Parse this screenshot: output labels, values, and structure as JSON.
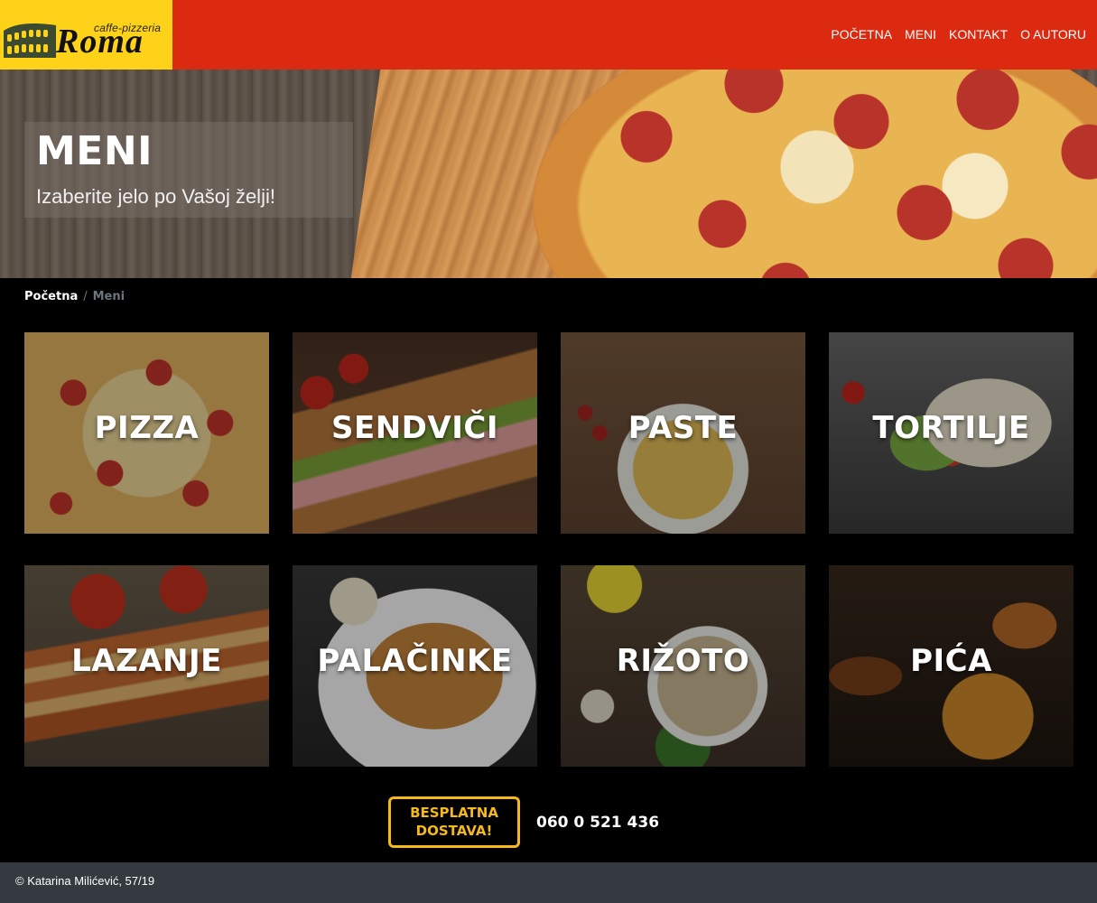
{
  "header": {
    "logo": {
      "small": "caffe-pizzeria",
      "big": "Roma"
    },
    "nav": [
      "POČETNA",
      "MENI",
      "KONTAKT",
      "O AUTORU"
    ],
    "colors": {
      "header_bg": "#dc2a10",
      "logo_bg": "#ffd21a"
    }
  },
  "hero": {
    "title": "MENI",
    "subtitle": "Izaberite jelo po Vašoj želji!"
  },
  "breadcrumb": {
    "home": "Početna",
    "separator": "/",
    "current": "Meni"
  },
  "categories": [
    {
      "label": "PIZZA",
      "image": "pizza"
    },
    {
      "label": "SENDVIČI",
      "image": "sandwich"
    },
    {
      "label": "PASTE",
      "image": "pasta"
    },
    {
      "label": "TORTILJE",
      "image": "tortilla"
    },
    {
      "label": "LAZANJE",
      "image": "lasagna"
    },
    {
      "label": "PALAČINKE",
      "image": "crepes"
    },
    {
      "label": "RIŽOTO",
      "image": "risotto"
    },
    {
      "label": "PIĆA",
      "image": "drinks"
    }
  ],
  "delivery": {
    "line1": "BESPLATNA",
    "line2": "DOSTAVA!",
    "phone": "060 0 521 436",
    "accent": "#f6b91a"
  },
  "footer": {
    "text": "© Katarina Milićević, 57/19"
  }
}
